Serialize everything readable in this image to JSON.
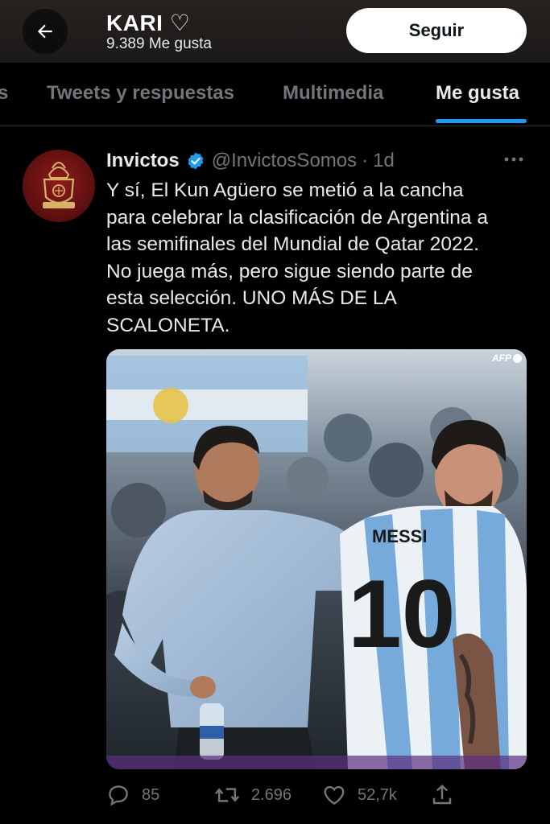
{
  "header": {
    "profile_name": "KARI ♡",
    "likes_count": "9.389 Me gusta",
    "follow_label": "Seguir"
  },
  "tabs": [
    {
      "label": "s"
    },
    {
      "label": "Tweets y respuestas"
    },
    {
      "label": "Multimedia"
    },
    {
      "label": "Me gusta",
      "active": true
    }
  ],
  "tweet": {
    "author_name": "Invictos",
    "handle": "@InvictosSomos",
    "separator": "·",
    "time": "1d",
    "text_lines": [
      "Y sí, El Kun Agüero se metió a la cancha",
      "para celebrar la clasificación de Argentina a",
      "las semifinales del Mundial de Qatar 2022.",
      "No juega más, pero sigue siendo parte de",
      "esta selección. UNO MÁS DE LA",
      "SCALONETA."
    ],
    "media": {
      "watermark": "AFP",
      "jersey_name": "MESSI",
      "jersey_number": "10"
    },
    "actions": {
      "replies": "85",
      "retweets": "2.696",
      "likes": "52,7k"
    }
  },
  "colors": {
    "accent": "#1d9bf0",
    "muted": "#71767b",
    "text": "#e7e9ea",
    "background": "#000000"
  }
}
